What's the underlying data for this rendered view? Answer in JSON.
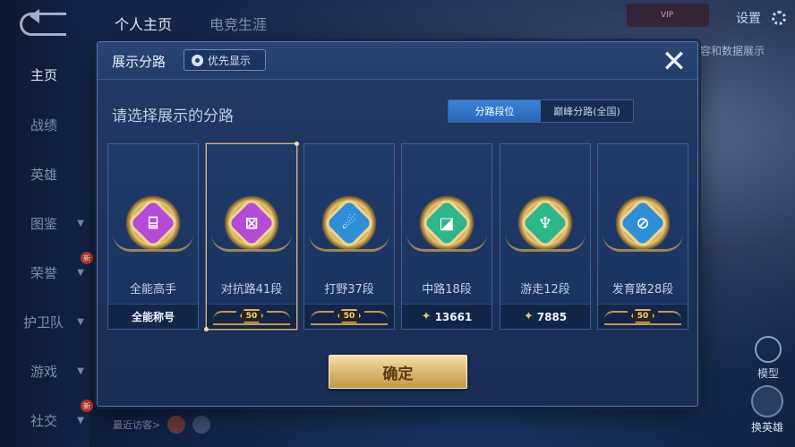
{
  "background": {
    "nav": [
      {
        "label": "主页",
        "active": true
      },
      {
        "label": "战绩"
      },
      {
        "label": "英雄"
      },
      {
        "label": "图鉴",
        "chevron": true
      },
      {
        "label": "荣誉",
        "chevron": true,
        "badge": "新"
      },
      {
        "label": "护卫队",
        "chevron": true
      },
      {
        "label": "游戏",
        "chevron": true
      },
      {
        "label": "社交",
        "chevron": true,
        "badge": "新"
      }
    ],
    "tabs": [
      "个人主页",
      "电竞生涯"
    ],
    "settings_label": "设置",
    "vip_text": "VIP",
    "right_peek_text": "容和数据展示",
    "model_label": "模型",
    "swap_hero_label": "换英雄",
    "recent_visitors_label": "最近访客>"
  },
  "modal": {
    "title": "展示分路",
    "priority_button": "优先显示",
    "close_icon": "✕",
    "subtitle": "请选择展示的分路",
    "toggle": [
      {
        "label": "分路段位",
        "active": true
      },
      {
        "label": "巅峰分路(全国)",
        "active": false
      }
    ],
    "cards": [
      {
        "label": "全能高手",
        "footer_type": "text",
        "footer_text": "全能称号",
        "color": "#b34bd6",
        "glyph": "⌸",
        "selected": false
      },
      {
        "label": "对抗路41段",
        "footer_type": "badge",
        "footer_text": "50",
        "color": "#b34bd6",
        "glyph": "⊠",
        "selected": true
      },
      {
        "label": "打野37段",
        "footer_type": "badge",
        "footer_text": "50",
        "color": "#2f8fd6",
        "glyph": "☄",
        "selected": false
      },
      {
        "label": "中路18段",
        "footer_type": "score",
        "footer_text": "13661",
        "color": "#2fb58a",
        "glyph": "◪",
        "selected": false
      },
      {
        "label": "游走12段",
        "footer_type": "score",
        "footer_text": "7885",
        "color": "#2fb58a",
        "glyph": "♆",
        "selected": false
      },
      {
        "label": "发育路28段",
        "footer_type": "badge",
        "footer_text": "50",
        "color": "#2f8fd6",
        "glyph": "⊘",
        "selected": false
      }
    ],
    "confirm_label": "确定"
  }
}
